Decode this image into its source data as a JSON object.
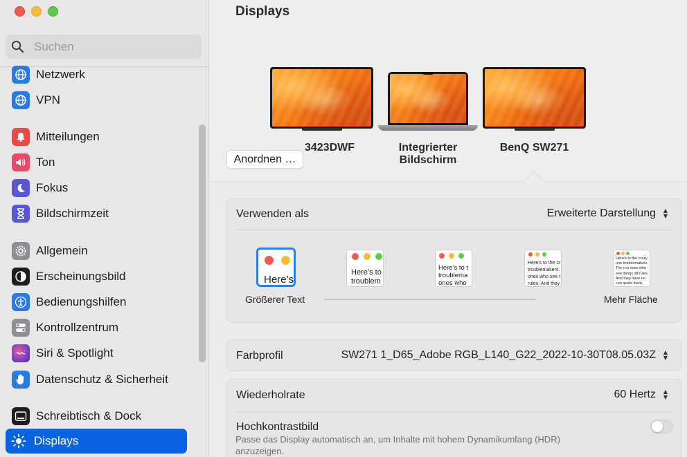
{
  "window": {
    "title": "Displays"
  },
  "search": {
    "placeholder": "Suchen"
  },
  "sidebar": {
    "items": [
      {
        "label": "Netzwerk",
        "icon": "globe-icon",
        "color": "#2a7ae4"
      },
      {
        "label": "VPN",
        "icon": "globe-icon",
        "color": "#2a7ae4"
      },
      {
        "label": "Mitteilungen",
        "icon": "bell-icon",
        "color": "#e84a45"
      },
      {
        "label": "Ton",
        "icon": "speaker-icon",
        "color": "#e84a6a"
      },
      {
        "label": "Fokus",
        "icon": "moon-icon",
        "color": "#5a54d6"
      },
      {
        "label": "Bildschirmzeit",
        "icon": "hourglass-icon",
        "color": "#5a54d6"
      },
      {
        "label": "Allgemein",
        "icon": "gear-icon",
        "color": "#8e8e93"
      },
      {
        "label": "Erscheinungsbild",
        "icon": "appearance-icon",
        "color": "#1d1d1f"
      },
      {
        "label": "Bedienungshilfen",
        "icon": "accessibility-icon",
        "color": "#2a7ae4"
      },
      {
        "label": "Kontrollzentrum",
        "icon": "switches-icon",
        "color": "#8e8e93"
      },
      {
        "label": "Siri & Spotlight",
        "icon": "siri-icon",
        "color": "#7a3fc8"
      },
      {
        "label": "Datenschutz & Sicherheit",
        "icon": "hand-icon",
        "color": "#2a7ae4"
      },
      {
        "label": "Schreibtisch & Dock",
        "icon": "dock-icon",
        "color": "#1d1d1f"
      },
      {
        "label": "Displays",
        "icon": "sun-icon",
        "color": "#2a7ae4"
      }
    ]
  },
  "arrange": {
    "button_label": "Anordnen …",
    "displays": [
      {
        "label": "3423DWF"
      },
      {
        "label": "Integrierter Bildschirm"
      },
      {
        "label": "BenQ SW271"
      }
    ]
  },
  "use_as": {
    "label": "Verwenden als",
    "value": "Erweiterte Darstellung",
    "options": [
      {
        "text": "Here’s"
      },
      {
        "text": "Here’s to troublem"
      },
      {
        "text": "Here’s to t troublema ones who"
      },
      {
        "text": "Here’s to the cr troublemakers. ones who see t rules. And they"
      },
      {
        "text": "Here’s to the crazy one troublemakers. The rou ones who see things dif rules. And they have no can quote them, disagr them. About the only th Because they change th"
      }
    ],
    "left_caption": "Größerer Text",
    "right_caption": "Mehr Fläche"
  },
  "color_profile": {
    "label": "Farbprofil",
    "value": "SW271 1_D65_Adobe RGB_L140_G22_2022-10-30T08.05.03Z"
  },
  "refresh": {
    "label": "Wiederholrate",
    "value": "60 Hertz"
  },
  "hdr": {
    "label": "Hochkontrastbild",
    "description": "Passe das Display automatisch an, um Inhalte mit hohem Dynamikumfang (HDR) anzuzeigen.",
    "enabled": false
  }
}
